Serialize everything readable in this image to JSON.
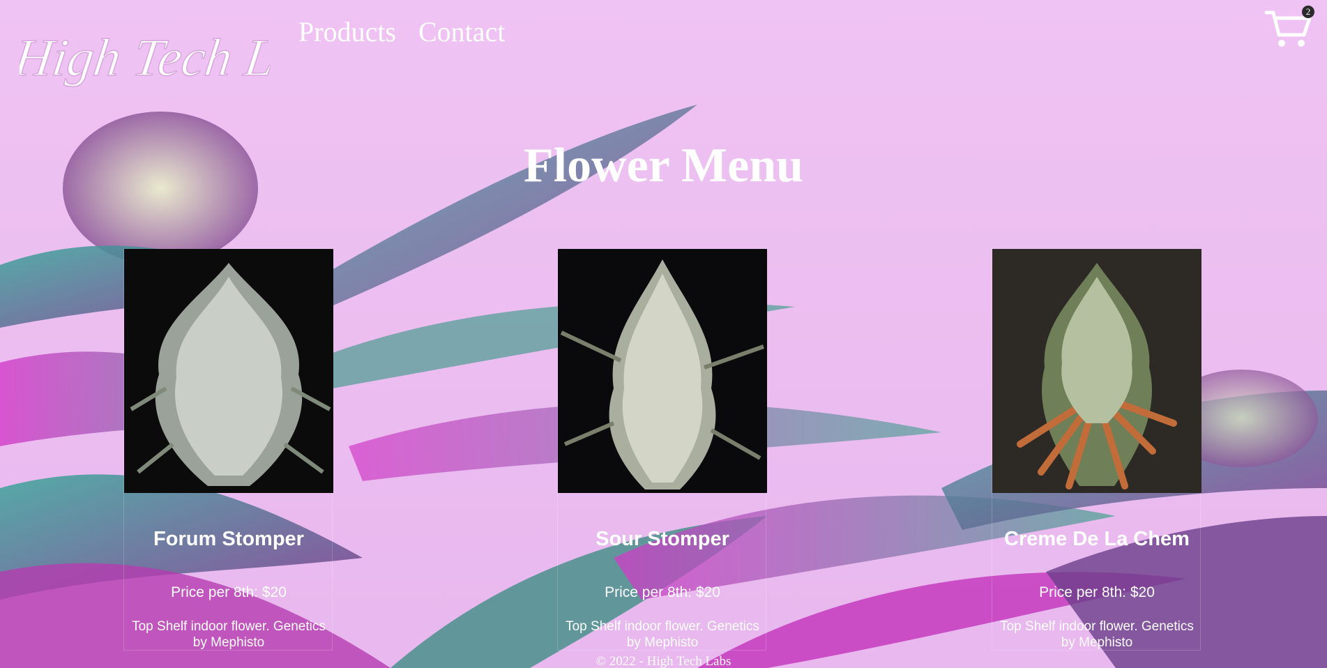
{
  "brand": {
    "logo_text": "High Tech Labs"
  },
  "nav": {
    "items": [
      {
        "label": "Products"
      },
      {
        "label": "Contact"
      }
    ]
  },
  "cart": {
    "icon": "cart-icon",
    "count": "2"
  },
  "page": {
    "title": "Flower Menu"
  },
  "products": [
    {
      "name": "Forum Stomper",
      "price": "Price per 8th: $20",
      "description": "Top Shelf indoor flower. Genetics by Mephisto",
      "image": "cannabis-flower-photo"
    },
    {
      "name": "Sour Stomper",
      "price": "Price per 8th: $20",
      "description": "Top Shelf indoor flower. Genetics by Mephisto",
      "image": "cannabis-flower-photo"
    },
    {
      "name": "Creme De La Chem",
      "price": "Price per 8th: $20",
      "description": "Top Shelf indoor flower. Genetics by Mephisto",
      "image": "cannabis-flower-photo"
    }
  ],
  "footer": {
    "text": "© 2022 - High Tech Labs"
  },
  "colors": {
    "background": "#ecc0f0",
    "leaf_teal": "#3f8f86",
    "leaf_magenta": "#c02ab8",
    "text": "#ffffff"
  }
}
